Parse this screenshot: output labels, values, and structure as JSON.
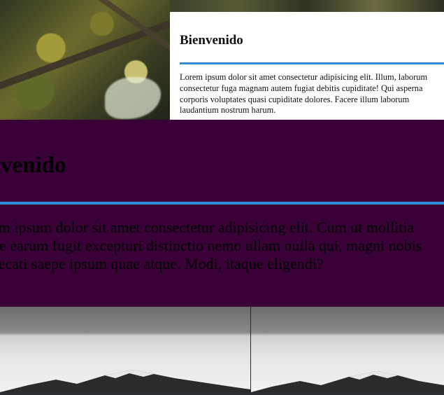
{
  "card": {
    "title": "Bienvenido",
    "text": "Lorem ipsum dolor sit amet consectetur adipisicing elit. Illum, laborum consectetur fuga magnam autem fugiat debitis cupiditate! Qui asperna corporis voluptates quasi cupiditate dolores. Facere illum laborum laudantium nostrum harum."
  },
  "band": {
    "title": "envenido",
    "line1": "em ipsum dolor sit amet consectetur adipisicing elit. Cum ut mollitia",
    "line2": "ue earum fugit excepturi distinctio nemo ullam nulla qui, magni nobis",
    "line3": "aecati saepe ipsum quae atque. Modi, itaque eligendi?"
  },
  "colors": {
    "accent": "#2e8bd6",
    "band_bg": "#3a0038",
    "card_bg": "#ffffff"
  }
}
